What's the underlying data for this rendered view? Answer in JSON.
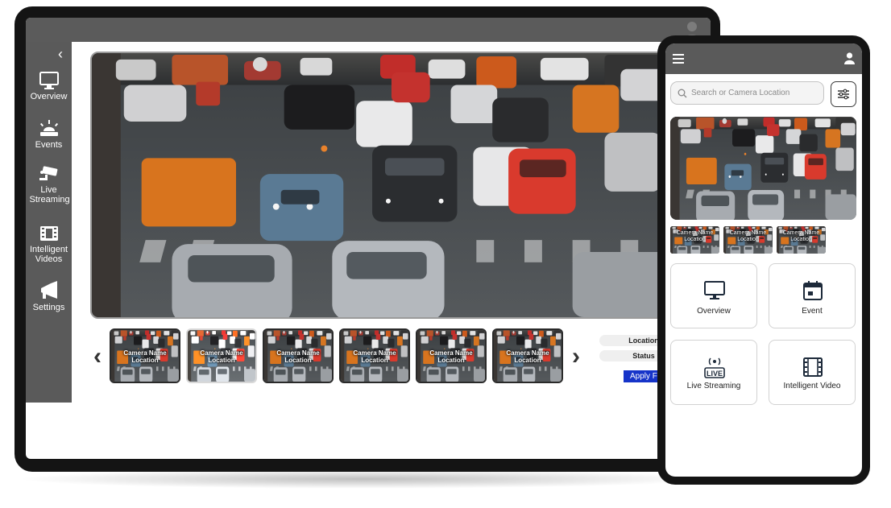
{
  "desktop": {
    "sidebar": {
      "collapse_icon": "chevron-left-icon",
      "items": [
        {
          "label": "Overview",
          "icon": "monitor-icon"
        },
        {
          "label": "Events",
          "icon": "siren-icon"
        },
        {
          "label": "Live Streaming",
          "icon": "cctv-icon"
        },
        {
          "label": "Intelligent Videos",
          "icon": "film-icon"
        },
        {
          "label": "Settings",
          "icon": "megaphone-icon"
        }
      ]
    },
    "thumbnails": [
      {
        "caption": "Camera Name Location"
      },
      {
        "caption": "Camera Name Location"
      },
      {
        "caption": "Camera Name Location"
      },
      {
        "caption": "Camera Name Location"
      },
      {
        "caption": "Camera Name Location"
      },
      {
        "caption": "Camera Name Location"
      }
    ],
    "filters": {
      "location_label": "Location",
      "status_label": "Status",
      "apply_label": "Apply Filter"
    },
    "nav_prev": "‹",
    "nav_next": "›"
  },
  "mobile": {
    "search": {
      "placeholder": "Search or Camera Location"
    },
    "thumbnails": [
      {
        "caption": "Camera Name Location"
      },
      {
        "caption": "Camera Name Location"
      },
      {
        "caption": "Camera Name Location"
      }
    ],
    "cards": [
      {
        "label": "Overview",
        "icon": "monitor-icon"
      },
      {
        "label": "Event",
        "icon": "calendar-icon"
      },
      {
        "label": "Live Streaming",
        "icon": "live-icon"
      },
      {
        "label": "Intelligent Video",
        "icon": "film-icon"
      }
    ]
  },
  "colors": {
    "sidebar": "#5a5a5a",
    "topbar": "#5b5b5b",
    "accent": "#1634c9",
    "device_frame": "#141414"
  }
}
